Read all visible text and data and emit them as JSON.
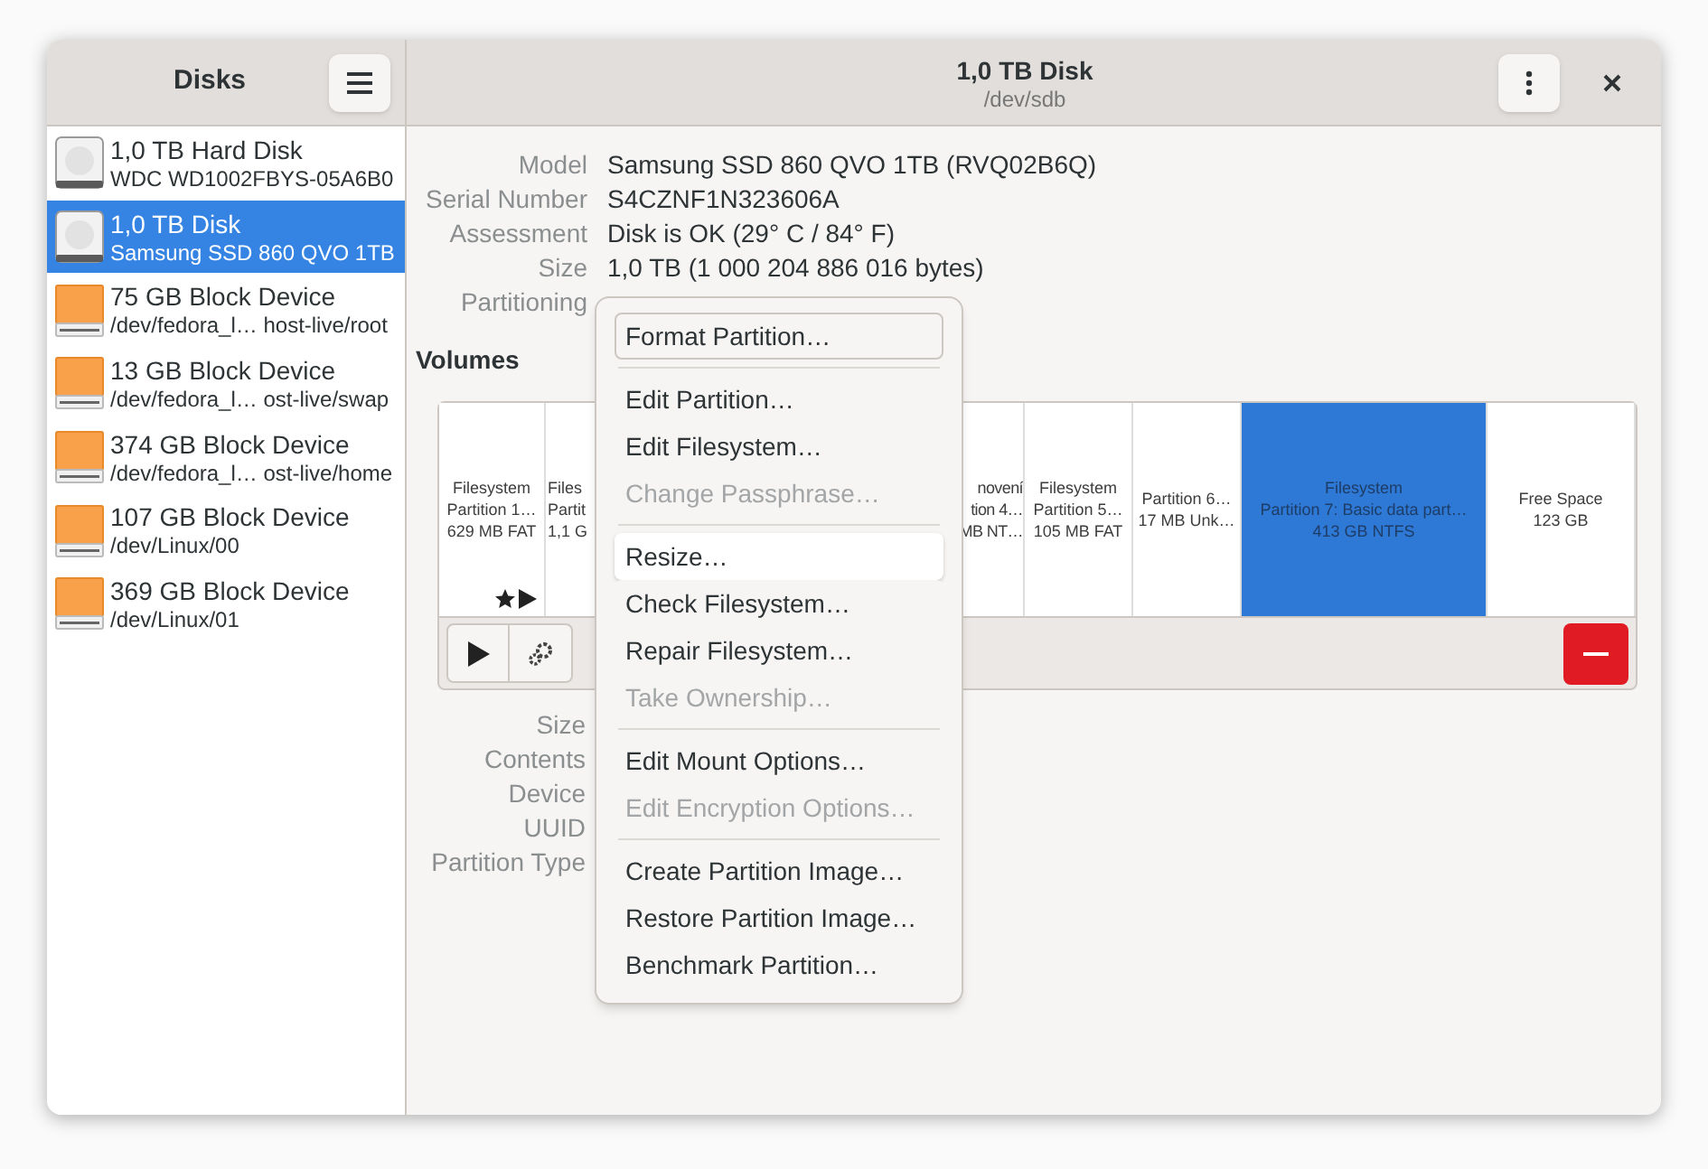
{
  "sidebar": {
    "title": "Disks",
    "items": [
      {
        "kind": "disk",
        "name": "1,0 TB Hard Disk",
        "detail": "WDC WD1002FBYS-05A6B0",
        "selected": false
      },
      {
        "kind": "disk",
        "name": "1,0 TB Disk",
        "detail": "Samsung SSD 860 QVO 1TB",
        "selected": true
      },
      {
        "kind": "block",
        "name": "75 GB Block Device",
        "detail": "/dev/fedora_l… host-live/root",
        "selected": false
      },
      {
        "kind": "block",
        "name": "13 GB Block Device",
        "detail": "/dev/fedora_l… ost-live/swap",
        "selected": false
      },
      {
        "kind": "block",
        "name": "374 GB Block Device",
        "detail": "/dev/fedora_l… ost-live/home",
        "selected": false
      },
      {
        "kind": "block",
        "name": "107 GB Block Device",
        "detail": "/dev/Linux/00",
        "selected": false
      },
      {
        "kind": "block",
        "name": "369 GB Block Device",
        "detail": "/dev/Linux/01",
        "selected": false
      }
    ]
  },
  "header": {
    "title": "1,0 TB Disk",
    "subtitle": "/dev/sdb"
  },
  "disk_info": [
    {
      "label": "Model",
      "value": "Samsung SSD 860 QVO 1TB (RVQ02B6Q)"
    },
    {
      "label": "Serial Number",
      "value": "S4CZNF1N323606A"
    },
    {
      "label": "Assessment",
      "value": "Disk is OK (29° C / 84° F)"
    },
    {
      "label": "Size",
      "value": "1,0 TB (1 000 204 886 016 bytes)"
    },
    {
      "label": "Partitioning"
    }
  ],
  "volumes": {
    "title": "Volumes",
    "segments": [
      {
        "lines": [
          "Filesystem",
          "Partition 1…",
          "629 MB FAT"
        ],
        "selected": false,
        "mounted": true,
        "kind": "full"
      },
      {
        "lines": [
          "Files",
          "Partit",
          "1,1 G"
        ],
        "selected": false,
        "mounted": false,
        "kind": "cut_right"
      },
      {
        "lines": [
          "novení",
          "tion 4…",
          "MB NT…"
        ],
        "selected": false,
        "mounted": false,
        "kind": "cut_left"
      },
      {
        "lines": [
          "Filesystem",
          "Partition 5…",
          "105 MB FAT"
        ],
        "selected": false,
        "mounted": false,
        "kind": "full"
      },
      {
        "lines": [
          "Partition 6…",
          "17 MB Unk…"
        ],
        "selected": false,
        "mounted": false,
        "kind": "full"
      },
      {
        "lines": [
          "Filesystem",
          "Partition 7: Basic data part…",
          "413 GB NTFS"
        ],
        "selected": true,
        "mounted": false,
        "kind": "full"
      },
      {
        "lines": [
          "Free Space",
          "123 GB"
        ],
        "selected": false,
        "mounted": false,
        "kind": "full"
      }
    ]
  },
  "partition_info": [
    {
      "label": "Size"
    },
    {
      "label": "Contents"
    },
    {
      "label": "Device"
    },
    {
      "label": "UUID"
    },
    {
      "label": "Partition Type"
    }
  ],
  "menu": [
    {
      "kind": "item",
      "label": "Format Partition…",
      "disabled": false,
      "focused": true,
      "hovered": false
    },
    {
      "kind": "separator"
    },
    {
      "kind": "item",
      "label": "Edit Partition…",
      "disabled": false,
      "focused": false,
      "hovered": false
    },
    {
      "kind": "item",
      "label": "Edit Filesystem…",
      "disabled": false,
      "focused": false,
      "hovered": false
    },
    {
      "kind": "item",
      "label": "Change Passphrase…",
      "disabled": true,
      "focused": false,
      "hovered": false
    },
    {
      "kind": "separator"
    },
    {
      "kind": "item",
      "label": "Resize…",
      "disabled": false,
      "focused": false,
      "hovered": true
    },
    {
      "kind": "item",
      "label": "Check Filesystem…",
      "disabled": false,
      "focused": false,
      "hovered": false
    },
    {
      "kind": "item",
      "label": "Repair Filesystem…",
      "disabled": false,
      "focused": false,
      "hovered": false
    },
    {
      "kind": "item",
      "label": "Take Ownership…",
      "disabled": true,
      "focused": false,
      "hovered": false
    },
    {
      "kind": "separator"
    },
    {
      "kind": "item",
      "label": "Edit Mount Options…",
      "disabled": false,
      "focused": false,
      "hovered": false
    },
    {
      "kind": "item",
      "label": "Edit Encryption Options…",
      "disabled": true,
      "focused": false,
      "hovered": false
    },
    {
      "kind": "separator"
    },
    {
      "kind": "item",
      "label": "Create Partition Image…",
      "disabled": false,
      "focused": false,
      "hovered": false
    },
    {
      "kind": "item",
      "label": "Restore Partition Image…",
      "disabled": false,
      "focused": false,
      "hovered": false
    },
    {
      "kind": "item",
      "label": "Benchmark Partition…",
      "disabled": false,
      "focused": false,
      "hovered": false
    }
  ]
}
